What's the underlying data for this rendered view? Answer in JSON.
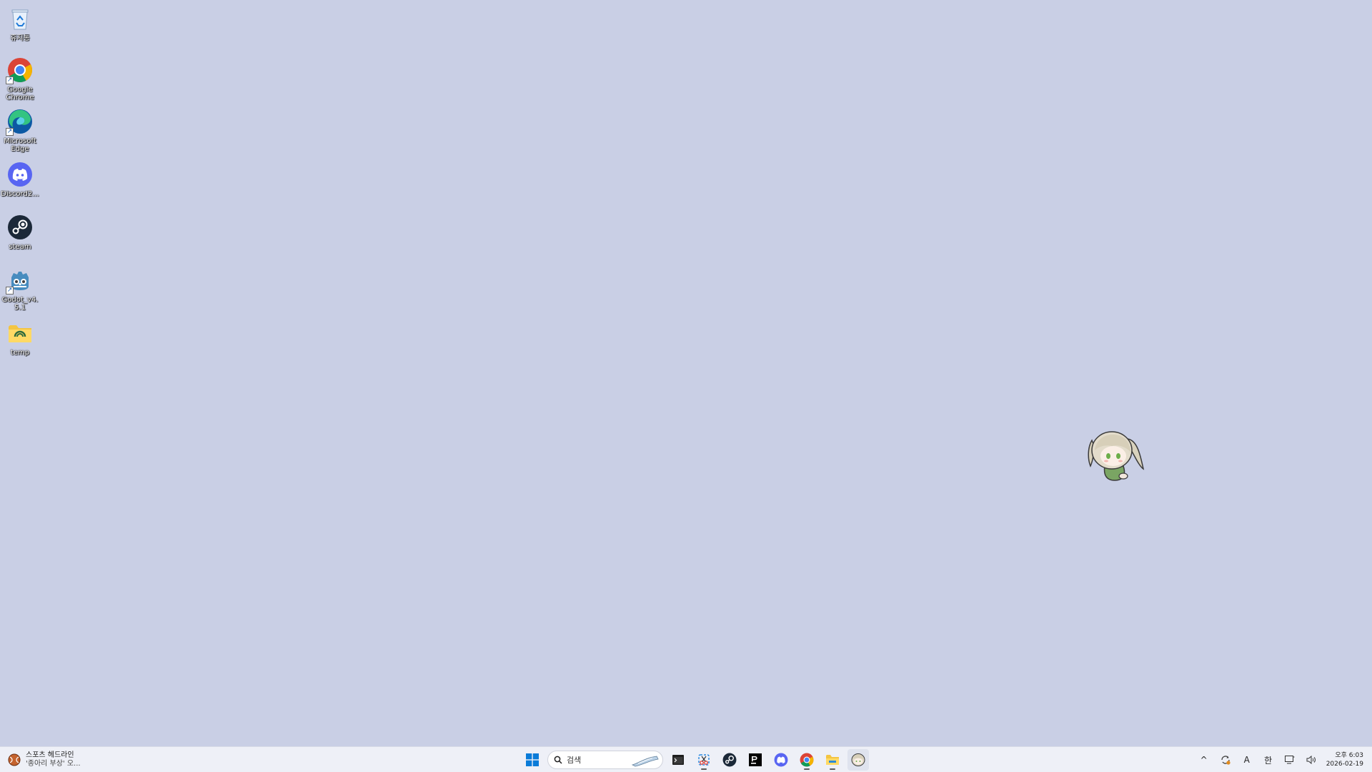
{
  "desktop": {
    "background_color": "#c9cfe5",
    "icons": [
      {
        "label": "휴지통",
        "icon": "recycle-bin-icon"
      },
      {
        "label": "Google Chrome",
        "icon": "chrome-icon"
      },
      {
        "label": "Microsoft Edge",
        "icon": "edge-icon"
      },
      {
        "label": "Discord2...",
        "icon": "discord-icon"
      },
      {
        "label": "steam",
        "icon": "steam-icon"
      },
      {
        "label": "Godot_v4.5.1",
        "icon": "godot-icon"
      },
      {
        "label": "temp",
        "icon": "folder-icon"
      }
    ]
  },
  "taskbar": {
    "widget": {
      "line1": "스포츠 헤드라인",
      "line2": "'종아리 부상' 오...",
      "icon": "baseball-icon"
    },
    "search": {
      "placeholder": "검색"
    },
    "apps": [
      {
        "name": "start",
        "icon": "windows-start-icon"
      },
      {
        "name": "terminal",
        "icon": "terminal-icon"
      },
      {
        "name": "snipping-tool",
        "icon": "snipping-tool-icon"
      },
      {
        "name": "steam",
        "icon": "steam-icon"
      },
      {
        "name": "jetbrains",
        "icon": "jetbrains-icon"
      },
      {
        "name": "discord",
        "icon": "discord-icon"
      },
      {
        "name": "chrome",
        "icon": "chrome-icon"
      },
      {
        "name": "file-explorer",
        "icon": "file-explorer-icon"
      },
      {
        "name": "mascot-app",
        "icon": "mascot-icon"
      }
    ],
    "tray": {
      "overflow_glyph": "^",
      "ime_mode": "A",
      "ime_lang": "한",
      "time_period": "오후",
      "time": "6:03",
      "date": "2026-02-19"
    }
  }
}
